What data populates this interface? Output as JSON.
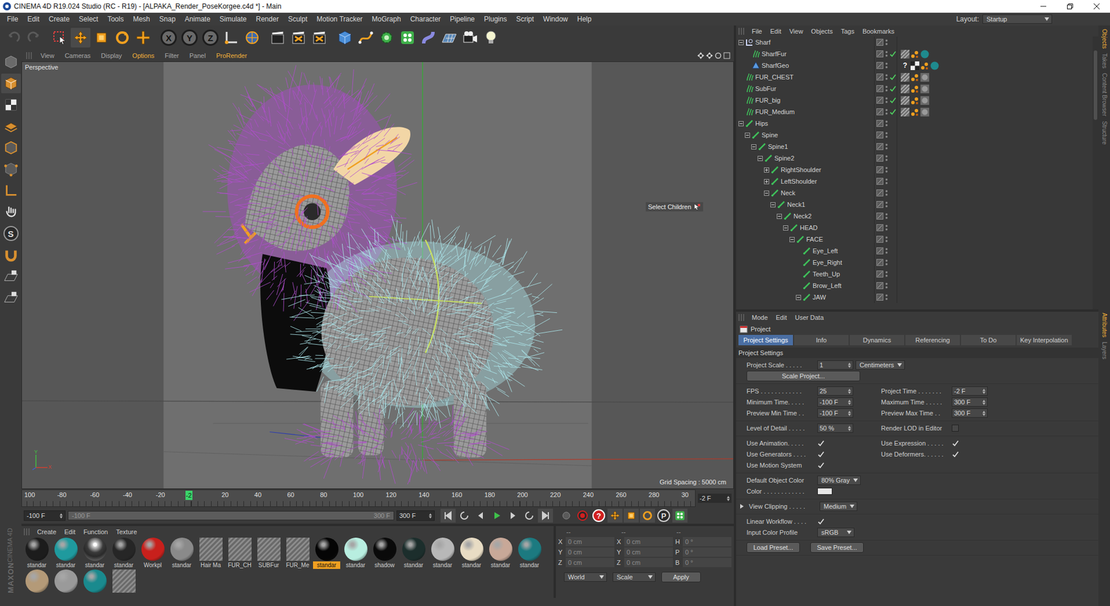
{
  "window": {
    "title": "CINEMA 4D R19.024 Studio (RC - R19) - [ALPAKA_Render_PoseKorgee.c4d *] - Main"
  },
  "menu": [
    "File",
    "Edit",
    "Create",
    "Select",
    "Tools",
    "Mesh",
    "Snap",
    "Animate",
    "Simulate",
    "Render",
    "Sculpt",
    "Motion Tracker",
    "MoGraph",
    "Character",
    "Pipeline",
    "Plugins",
    "Script",
    "Window",
    "Help"
  ],
  "layout": {
    "label": "Layout:",
    "value": "Startup"
  },
  "toolbar": {
    "axes": [
      "X",
      "Y",
      "Z"
    ]
  },
  "left_toolbar": {
    "letter": "S"
  },
  "logo": [
    "MAXON",
    "CINEMA 4D"
  ],
  "viewport": {
    "menu": [
      {
        "label": "View",
        "highlighted": false
      },
      {
        "label": "Cameras",
        "highlighted": false
      },
      {
        "label": "Display",
        "highlighted": false
      },
      {
        "label": "Options",
        "highlighted": true
      },
      {
        "label": "Filter",
        "highlighted": false
      },
      {
        "label": "Panel",
        "highlighted": false
      },
      {
        "label": "ProRender",
        "highlighted": true
      }
    ],
    "camera": "Perspective",
    "grid": "Grid Spacing : 5000 cm",
    "tooltip": "Select Children",
    "axes": [
      "Y",
      "X"
    ]
  },
  "timeline": {
    "ticks": [
      "100",
      "-80",
      "-60",
      "-40",
      "-20",
      null,
      "20",
      "40",
      "60",
      "80",
      "100",
      "120",
      "140",
      "160",
      "180",
      "200",
      "220",
      "240",
      "260",
      "280",
      "30"
    ],
    "current": "-2",
    "level": 0.245,
    "frame": "-2 F",
    "min": "-100 F",
    "range_start": "-100 F",
    "range_end": "300 F",
    "max": "300 F",
    "record_glyphs": [
      "?",
      "P"
    ]
  },
  "materials": {
    "menu": [
      "Create",
      "Edit",
      "Function",
      "Texture"
    ],
    "rows": [
      [
        {
          "name": "standar",
          "kind": "sphere",
          "color": "#1c1c1c",
          "selected": false
        },
        {
          "name": "standar",
          "kind": "sphere",
          "color": "#1f9a9e",
          "selected": false
        },
        {
          "name": "standar",
          "kind": "chrome",
          "color": "#2a2a2a",
          "selected": false
        },
        {
          "name": "standar",
          "kind": "sphere",
          "color": "#262626",
          "selected": false
        },
        {
          "name": "Workpl",
          "kind": "sphere",
          "color": "#c8201c",
          "selected": false
        },
        {
          "name": "standar",
          "kind": "sphere",
          "color": "#8a8a8a",
          "selected": false
        },
        {
          "name": "Hair Ma",
          "kind": "hair",
          "color": "#6a6a6a",
          "selected": false
        },
        {
          "name": "FUR_CH",
          "kind": "hair",
          "color": "#6a6a6a",
          "selected": false
        },
        {
          "name": "SUBFur",
          "kind": "hair",
          "color": "#6a6a6a",
          "selected": false
        },
        {
          "name": "FUR_Me",
          "kind": "hair",
          "color": "#6a6a6a",
          "selected": false
        },
        {
          "name": "standar",
          "kind": "sphere",
          "color": "#050505",
          "selected": true
        },
        {
          "name": "standar",
          "kind": "sphere",
          "color": "#b8eee0",
          "selected": false
        },
        {
          "name": "shadow",
          "kind": "sphere",
          "color": "#0a0a0a",
          "selected": false
        },
        {
          "name": "standar",
          "kind": "sphere",
          "color": "#1c2e2c",
          "selected": false
        },
        {
          "name": "standar",
          "kind": "sphere",
          "color": "#b8b8b8",
          "selected": false
        },
        {
          "name": "standar",
          "kind": "sphere",
          "color": "#e8dcc4",
          "selected": false
        },
        {
          "name": "standar",
          "kind": "sphere",
          "color": "#c8a898",
          "selected": false
        },
        {
          "name": "standar",
          "kind": "sphere",
          "color": "#1c7a80",
          "selected": false
        }
      ],
      [
        {
          "name": "",
          "kind": "sphere",
          "color": "#b49a78",
          "selected": false
        },
        {
          "name": "",
          "kind": "sphere",
          "color": "#9a9a9a",
          "selected": false
        },
        {
          "name": "",
          "kind": "sphere",
          "color": "#1a8a8e",
          "selected": false
        },
        {
          "name": "",
          "kind": "hair",
          "color": "#6a6a6a",
          "selected": false
        }
      ]
    ]
  },
  "coordinates": {
    "headers": [
      "--",
      "--",
      "--"
    ],
    "rows": [
      [
        {
          "axis": "X",
          "value": "0 cm"
        },
        {
          "axis": "X",
          "value": "0 cm"
        },
        {
          "axis": "H",
          "value": "0 °"
        }
      ],
      [
        {
          "axis": "Y",
          "value": "0 cm"
        },
        {
          "axis": "Y",
          "value": "0 cm"
        },
        {
          "axis": "P",
          "value": "0 °"
        }
      ],
      [
        {
          "axis": "Z",
          "value": "0 cm"
        },
        {
          "axis": "Z",
          "value": "0 cm"
        },
        {
          "axis": "B",
          "value": "0 °"
        }
      ]
    ],
    "modes": [
      "World",
      "Scale"
    ],
    "apply": "Apply"
  },
  "objects": {
    "menu": [
      "File",
      "Edit",
      "View",
      "Objects",
      "Tags",
      "Bookmarks"
    ],
    "items": [
      {
        "name": "Sharf",
        "depth": 0,
        "kind": "null",
        "expandable": true,
        "expanded": true,
        "enabled": false,
        "tags": []
      },
      {
        "name": "SharfFur",
        "depth": 1,
        "kind": "hair",
        "expandable": false,
        "expanded": false,
        "enabled": true,
        "tags": [
          {
            "kind": "checker"
          },
          {
            "kind": "dots"
          },
          {
            "kind": "teal"
          }
        ]
      },
      {
        "name": "SharfGeo",
        "depth": 1,
        "kind": "poly",
        "expandable": false,
        "expanded": false,
        "enabled": false,
        "tags": [
          {
            "kind": "unknown",
            "glyph": "?"
          },
          {
            "kind": "chess"
          },
          {
            "kind": "dots"
          },
          {
            "kind": "teal"
          }
        ]
      },
      {
        "name": "FUR_CHEST",
        "depth": 0,
        "kind": "hair",
        "expandable": false,
        "expanded": false,
        "enabled": true,
        "tags": [
          {
            "kind": "checker"
          },
          {
            "kind": "dots"
          },
          {
            "kind": "gray"
          }
        ]
      },
      {
        "name": "SubFur",
        "depth": 0,
        "kind": "hair",
        "expandable": false,
        "expanded": false,
        "enabled": true,
        "tags": [
          {
            "kind": "checker"
          },
          {
            "kind": "dots"
          },
          {
            "kind": "gray"
          }
        ]
      },
      {
        "name": "FUR_big",
        "depth": 0,
        "kind": "hair",
        "expandable": false,
        "expanded": false,
        "enabled": true,
        "tags": [
          {
            "kind": "checker"
          },
          {
            "kind": "dots"
          },
          {
            "kind": "gray"
          }
        ]
      },
      {
        "name": "FUR_Medium",
        "depth": 0,
        "kind": "hair",
        "expandable": false,
        "expanded": false,
        "enabled": true,
        "tags": [
          {
            "kind": "checker"
          },
          {
            "kind": "dots"
          },
          {
            "kind": "gray"
          }
        ]
      },
      {
        "name": "Hips",
        "depth": 0,
        "kind": "bone",
        "expandable": true,
        "expanded": true,
        "enabled": false,
        "tags": []
      },
      {
        "name": "Spine",
        "depth": 1,
        "kind": "bone",
        "expandable": true,
        "expanded": true,
        "enabled": false,
        "tags": []
      },
      {
        "name": "Spine1",
        "depth": 2,
        "kind": "bone",
        "expandable": true,
        "expanded": true,
        "enabled": false,
        "tags": []
      },
      {
        "name": "Spine2",
        "depth": 3,
        "kind": "bone",
        "expandable": true,
        "expanded": true,
        "enabled": false,
        "tags": []
      },
      {
        "name": "RightShoulder",
        "depth": 4,
        "kind": "bone",
        "expandable": true,
        "expanded": false,
        "enabled": false,
        "tags": []
      },
      {
        "name": "LeftShoulder",
        "depth": 4,
        "kind": "bone",
        "expandable": true,
        "expanded": false,
        "enabled": false,
        "tags": []
      },
      {
        "name": "Neck",
        "depth": 4,
        "kind": "bone",
        "expandable": true,
        "expanded": true,
        "enabled": false,
        "tags": []
      },
      {
        "name": "Neck1",
        "depth": 5,
        "kind": "bone",
        "expandable": true,
        "expanded": true,
        "enabled": false,
        "tags": []
      },
      {
        "name": "Neck2",
        "depth": 6,
        "kind": "bone",
        "expandable": true,
        "expanded": true,
        "enabled": false,
        "tags": []
      },
      {
        "name": "HEAD",
        "depth": 7,
        "kind": "bone",
        "expandable": true,
        "expanded": true,
        "enabled": false,
        "tags": []
      },
      {
        "name": "FACE",
        "depth": 8,
        "kind": "bone",
        "expandable": true,
        "expanded": true,
        "enabled": false,
        "tags": []
      },
      {
        "name": "Eye_Left",
        "depth": 9,
        "kind": "bone",
        "expandable": false,
        "expanded": false,
        "enabled": false,
        "tags": []
      },
      {
        "name": "Eye_Right",
        "depth": 9,
        "kind": "bone",
        "expandable": false,
        "expanded": false,
        "enabled": false,
        "tags": []
      },
      {
        "name": "Teeth_Up",
        "depth": 9,
        "kind": "bone",
        "expandable": false,
        "expanded": false,
        "enabled": false,
        "tags": []
      },
      {
        "name": "Brow_Left",
        "depth": 9,
        "kind": "bone",
        "expandable": false,
        "expanded": false,
        "enabled": false,
        "tags": []
      },
      {
        "name": "JAW",
        "depth": 9,
        "kind": "bone",
        "expandable": true,
        "expanded": true,
        "enabled": false,
        "tags": []
      }
    ]
  },
  "attributes": {
    "menu": [
      "Mode",
      "Edit",
      "User Data"
    ],
    "title": "Project",
    "tabs": [
      {
        "label": "Project Settings",
        "selected": true
      },
      {
        "label": "Info",
        "selected": false
      },
      {
        "label": "Dynamics",
        "selected": false
      },
      {
        "label": "Referencing",
        "selected": false
      },
      {
        "label": "To Do",
        "selected": false
      },
      {
        "label": "Key Interpolation",
        "selected": false
      }
    ],
    "section": "Project Settings",
    "groups": [
      [
        [
          {
            "kind": "number",
            "label": "Project Scale . . . . .",
            "value": "1",
            "unit": "Centimeters"
          }
        ],
        [
          {
            "kind": "button",
            "value": "Scale Project..."
          }
        ]
      ],
      [
        [
          {
            "kind": "number",
            "label": "FPS . . . . . . . . . . . .",
            "value": "25"
          },
          {
            "kind": "number",
            "label": "Project Time . . . . . . .",
            "value": "-2 F"
          }
        ],
        [
          {
            "kind": "number",
            "label": "Minimum Time. . . . .",
            "value": "-100 F"
          },
          {
            "kind": "number",
            "label": "Maximum Time . . . . .",
            "value": "300 F"
          }
        ],
        [
          {
            "kind": "number",
            "label": "Preview Min Time . .",
            "value": "-100 F"
          },
          {
            "kind": "number",
            "label": "Preview Max Time . .",
            "value": "300 F"
          }
        ]
      ],
      [
        [
          {
            "kind": "number",
            "label": "Level of Detail . . . . .",
            "value": "50 %"
          },
          {
            "kind": "check",
            "label": "Render LOD in Editor",
            "checked": false
          }
        ]
      ],
      [
        [
          {
            "kind": "check",
            "label": "Use Animation. . . . .",
            "checked": true
          },
          {
            "kind": "check",
            "label": "Use Expression . . . . .",
            "checked": true
          }
        ],
        [
          {
            "kind": "check",
            "label": "Use Generators . . . .",
            "checked": true
          },
          {
            "kind": "check",
            "label": "Use Deformers. . . . . .",
            "checked": true
          }
        ],
        [
          {
            "kind": "check",
            "label": "Use Motion System",
            "checked": true
          }
        ]
      ],
      [
        [
          {
            "kind": "dropdown",
            "label": "Default Object Color",
            "value": "80% Gray"
          }
        ],
        [
          {
            "kind": "color",
            "label": "Color . . . . . . . . . . . .",
            "color": "#e6e6e6"
          }
        ]
      ],
      [
        [
          {
            "kind": "dropdown",
            "label": "View Clipping . . . . .",
            "value": "Medium",
            "expanded": false
          }
        ]
      ],
      [
        [
          {
            "kind": "check",
            "label": "Linear Workflow . . . .",
            "checked": true
          }
        ],
        [
          {
            "kind": "dropdown",
            "label": "Input Color Profile",
            "value": "sRGB"
          }
        ]
      ],
      [
        [
          {
            "kind": "button",
            "value": "Load Preset..."
          },
          {
            "kind": "button",
            "value": "Save Preset..."
          }
        ]
      ]
    ]
  },
  "side_tabs": {
    "top": [
      {
        "label": "Objects",
        "selected": true
      },
      {
        "label": "Takes",
        "selected": false
      },
      {
        "label": "Content Browser",
        "selected": false
      },
      {
        "label": "Structure",
        "selected": false
      }
    ],
    "bottom": [
      {
        "label": "Attributes",
        "selected": true
      },
      {
        "label": "Layers",
        "selected": false
      }
    ]
  }
}
